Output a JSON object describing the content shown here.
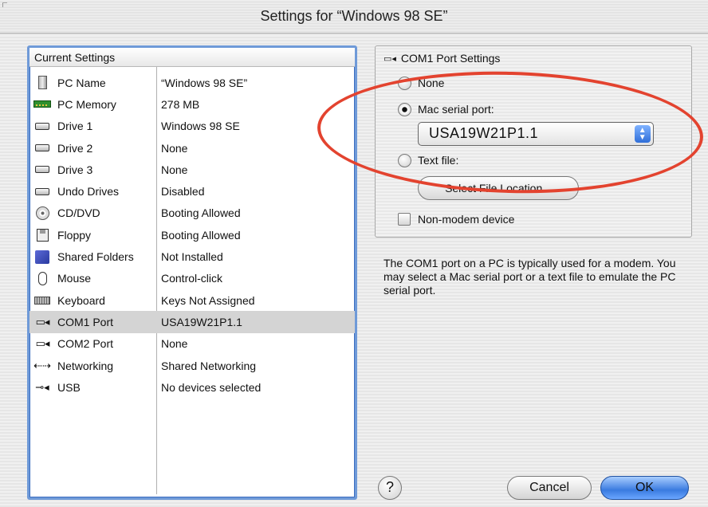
{
  "window": {
    "title": "Settings for “Windows 98 SE”"
  },
  "left_panel": {
    "header": "Current Settings",
    "rows": [
      {
        "name": "PC Name",
        "value": "“Windows 98 SE”",
        "icon": "pc-tower-icon"
      },
      {
        "name": "PC Memory",
        "value": "278 MB",
        "icon": "memory-chip-icon"
      },
      {
        "name": "Drive 1",
        "value": "Windows 98 SE",
        "icon": "hard-drive-icon"
      },
      {
        "name": "Drive 2",
        "value": "None",
        "icon": "hard-drive-icon"
      },
      {
        "name": "Drive 3",
        "value": "None",
        "icon": "hard-drive-icon"
      },
      {
        "name": "Undo Drives",
        "value": "Disabled",
        "icon": "undo-drive-icon"
      },
      {
        "name": "CD/DVD",
        "value": "Booting Allowed",
        "icon": "cd-icon"
      },
      {
        "name": "Floppy",
        "value": "Booting Allowed",
        "icon": "floppy-icon"
      },
      {
        "name": "Shared Folders",
        "value": "Not Installed",
        "icon": "folder-icon"
      },
      {
        "name": "Mouse",
        "value": "Control-click",
        "icon": "mouse-icon"
      },
      {
        "name": "Keyboard",
        "value": "Keys Not Assigned",
        "icon": "keyboard-icon"
      },
      {
        "name": "COM1 Port",
        "value": "USA19W21P1.1",
        "icon": "serial-port-icon",
        "selected": true
      },
      {
        "name": "COM2 Port",
        "value": "None",
        "icon": "serial-port-icon"
      },
      {
        "name": "Networking",
        "value": "Shared Networking",
        "icon": "networking-icon"
      },
      {
        "name": "USB",
        "value": "No devices selected",
        "icon": "usb-icon"
      }
    ]
  },
  "right_panel": {
    "group_title": "COM1 Port Settings",
    "radio_none": "None",
    "radio_mac_serial": "Mac serial port:",
    "serial_port_selected": "USA19W21P1.1",
    "radio_text_file": "Text file:",
    "select_file_button": "Select File Location...",
    "non_modem_checkbox": "Non-modem device",
    "description": "The COM1 port on a PC is typically used for a modem. You may select a Mac serial port or a text file to emulate the PC serial port."
  },
  "footer": {
    "help_label": "?",
    "cancel_label": "Cancel",
    "ok_label": "OK"
  },
  "colors": {
    "selection_border": "#6f9ad8",
    "annotation_ellipse": "#e3432f",
    "default_button": "#3a7be0"
  }
}
